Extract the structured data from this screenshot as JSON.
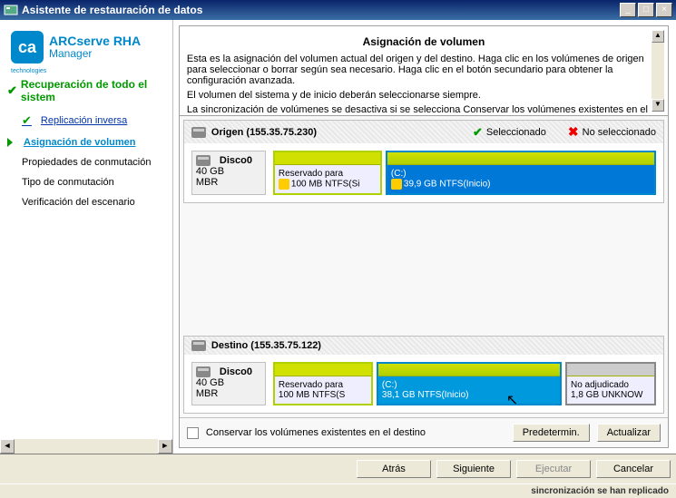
{
  "window": {
    "title": "Asistente de restauración de datos"
  },
  "brand": {
    "logo": "ca",
    "tech": "technologies",
    "product": "ARCserve RHA",
    "sub": "Manager"
  },
  "nav": {
    "header": "Recuperación de todo el sistem",
    "items": [
      {
        "label": "Replicación inversa",
        "done": true
      },
      {
        "label": "Asignación de volumen",
        "active": true
      },
      {
        "label": "Propiedades de conmutación"
      },
      {
        "label": "Tipo de conmutación"
      },
      {
        "label": "Verificación del escenario"
      }
    ]
  },
  "desc": {
    "heading": "Asignación de volumen",
    "p1": "Esta es la asignación del volumen actual del origen y del destino. Haga clic en los volúmenes de origen para seleccionar o borrar según sea necesario. Haga clic en el botón secundario para obtener la configuración avanzada.",
    "p2": "El volumen del sistema y de inicio deberán seleccionarse siempre.",
    "p3": "La sincronización de volúmenes se desactiva si se selecciona Conservar los volúmenes existentes en el"
  },
  "legend": {
    "sel": "Seleccionado",
    "unsel": "No seleccionado"
  },
  "source": {
    "title_prefix": "Origen",
    "ip": "(155.35.75.230)",
    "disk": {
      "name": "Disco0",
      "size": "40 GB",
      "type": "MBR"
    },
    "parts": [
      {
        "title": "Reservado para",
        "detail": "100 MB NTFS(Si"
      },
      {
        "title": "(C:)",
        "detail": "39,9 GB NTFS(Inicio)"
      }
    ]
  },
  "dest": {
    "title_prefix": "Destino",
    "ip": "(155.35.75.122)",
    "disk": {
      "name": "Disco0",
      "size": "40 GB",
      "type": "MBR"
    },
    "parts": [
      {
        "title": "Reservado para",
        "detail": "100 MB NTFS(S"
      },
      {
        "title": "(C:)",
        "detail": "38,1 GB NTFS(Inicio)"
      },
      {
        "title": "No adjudicado",
        "detail": "1,8 GB UNKNOW"
      }
    ]
  },
  "preserve": "Conservar los volúmenes existentes en el destino",
  "buttons": {
    "default": "Predetermin.",
    "update": "Actualizar",
    "back": "Atrás",
    "next": "Siguiente",
    "run": "Ejecutar",
    "cancel": "Cancelar"
  },
  "status": "sincronización se han replicado"
}
